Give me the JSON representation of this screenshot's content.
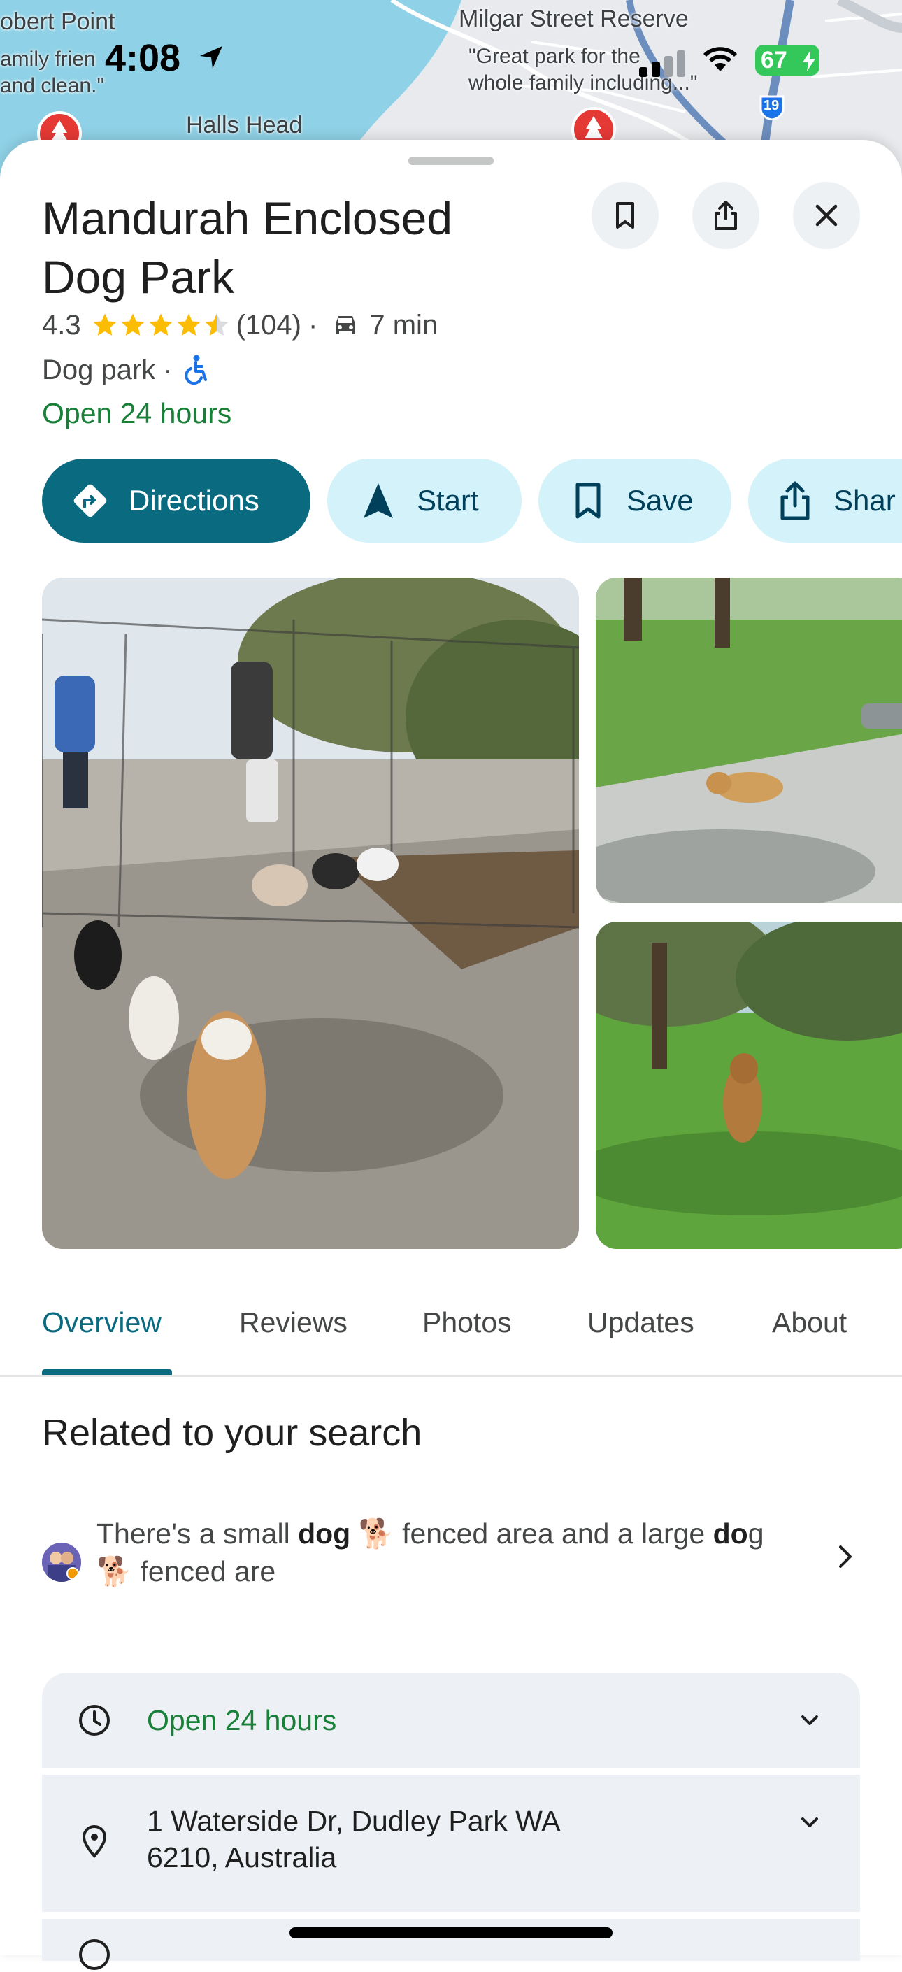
{
  "status_bar": {
    "time": "4:08",
    "battery": "67"
  },
  "map": {
    "labels": [
      "obert Point",
      "Milgar Street Reserve",
      "Halls Head"
    ],
    "review_left": [
      "amily frien",
      "and clean.\""
    ],
    "review_right": [
      "\"Great park for the",
      "whole family including...\""
    ],
    "route_number": "19"
  },
  "place": {
    "name": "Mandurah Enclosed Dog Park",
    "rating": "4.3",
    "review_count": "(104)",
    "separator": "·",
    "drive_time": "7 min",
    "category": "Dog park ·",
    "hours_status": "Open 24 hours"
  },
  "actions": [
    {
      "label": "Directions",
      "icon": "directions-icon"
    },
    {
      "label": "Start",
      "icon": "navigation-arrow-icon"
    },
    {
      "label": "Save",
      "icon": "bookmark-icon"
    },
    {
      "label": "Shar",
      "icon": "share-icon"
    }
  ],
  "tabs": [
    "Overview",
    "Reviews",
    "Photos",
    "Updates",
    "About"
  ],
  "related": {
    "heading": "Related to your search",
    "snippet_1": "There's a small ",
    "snippet_bold_1": "dog",
    "snippet_2": " fenced area and a large ",
    "snippet_bold_2": "do",
    "snippet_3": "g",
    "snippet_4": " fenced are",
    "emoji": "🐕"
  },
  "info": {
    "hours": "Open 24 hours",
    "address_line1": "1 Waterside Dr, Dudley Park WA",
    "address_line2": "6210, Australia"
  },
  "colors": {
    "accent": "#0a6b80",
    "chip_bg": "#d3f2fa",
    "open_green": "#188038",
    "star": "#fbbc04",
    "card_bg": "#edf1f5"
  }
}
